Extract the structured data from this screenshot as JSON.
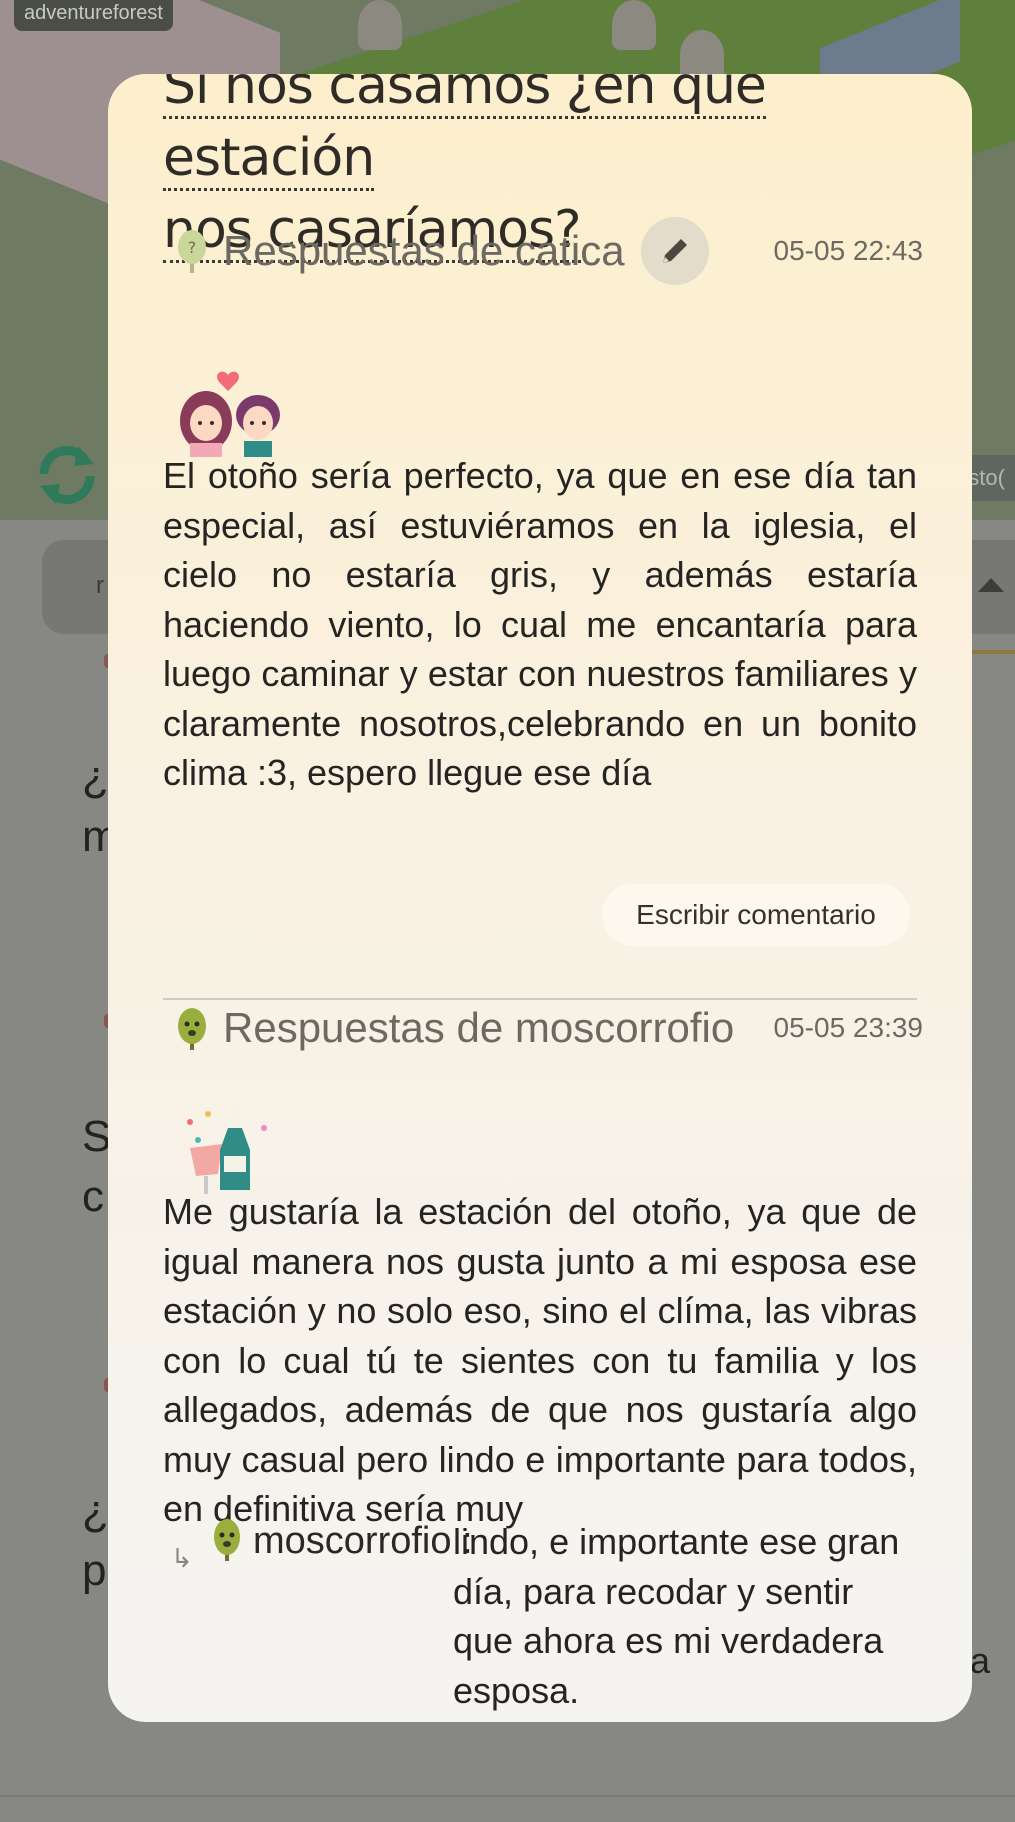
{
  "background": {
    "scene_tag": "adventureforest",
    "right_pill_text": "esto(",
    "card_letter": "r",
    "row_fragments": [
      "¿l",
      "m",
      "S",
      "c",
      "¿l",
      "p",
      "ia"
    ]
  },
  "modal": {
    "question_line1": "Si nos casamos ¿en qué estación",
    "question_line2": "nos casaríamos?",
    "answers": [
      {
        "user_label": "Respuestas de catica",
        "time": "05-05 22:43",
        "sticker": "couple-sticker",
        "text": "El otoño sería perfecto, ya que en ese día tan especial, así estuviéramos en la iglesia, el cielo no estaría gris, y además estaría haciendo viento, lo cual me encantaría para luego caminar y estar con nuestros familiares y claramente nosotros,celebrando en un bonito clima :3, espero llegue ese día",
        "comment_button": "Escribir comentario"
      },
      {
        "user_label": "Respuestas de moscorrofio",
        "time": "05-05 23:39",
        "sticker": "champagne-sticker",
        "text": "Me gustaría la estación del otoño, ya que de igual manera nos gusta junto a mi esposa ese estación y no solo eso, sino el clíma, las vibras con lo cual tú te sientes con tu familia y los allegados, además de que nos gustaría algo muy casual pero lindo e importante para todos, en definitiva sería muy",
        "reply": {
          "user": "moscorrofio :",
          "text": "lindo, e importante ese gran día, para recodar y sentir que ahora es mi verdadera esposa."
        }
      }
    ]
  },
  "colors": {
    "modal_top": "#fdefcc",
    "modal_bottom": "#f5f4f2",
    "refresh_green": "#2f7a5a",
    "text_dark": "#262422",
    "text_muted": "#6c6963"
  }
}
